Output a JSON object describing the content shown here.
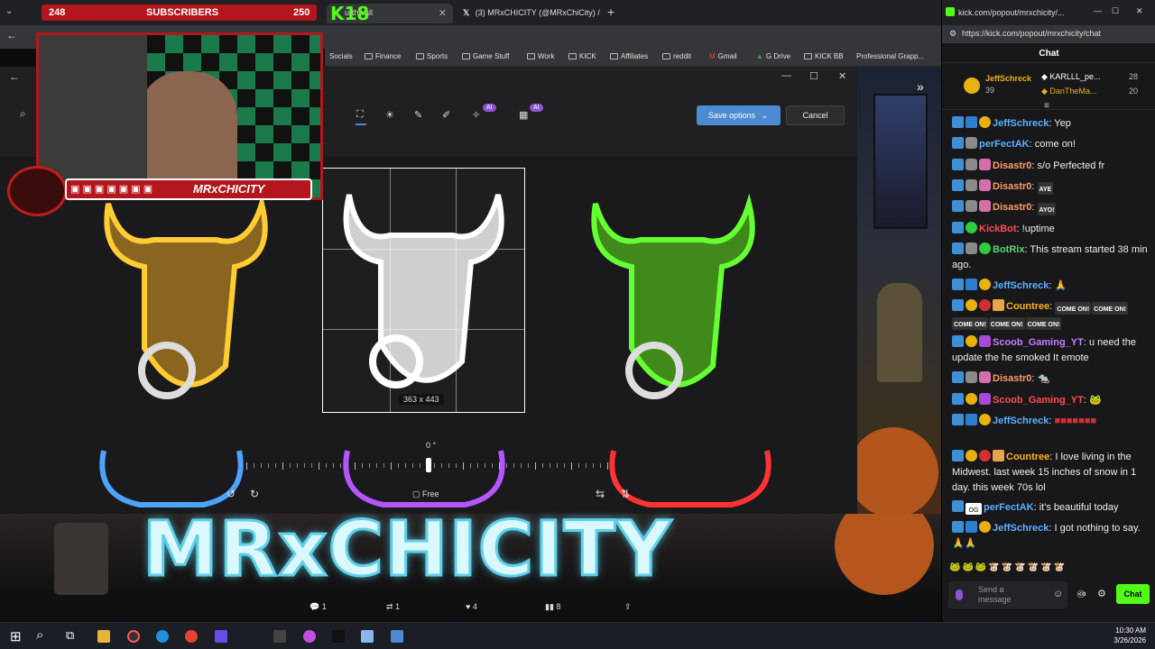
{
  "browser": {
    "subscribers_bar": {
      "count": "248",
      "label": "SUBSCRIBERS",
      "goal": "250",
      "kick_count": "18"
    },
    "tabs": [
      {
        "label": "urthwall"
      },
      {
        "label": "(3) MRxCHICITY (@MRxChiCity) / X"
      }
    ],
    "bookmarks": [
      "Socials",
      "Finance",
      "Sports",
      "Game Stuff",
      "Work",
      "KICK",
      "Affiliates",
      "reddit",
      "Gmail",
      "G Drive",
      "KICK BB",
      "Professional Grapp..."
    ]
  },
  "editor": {
    "save_label": "Save options",
    "cancel_label": "Cancel",
    "ai_badge": "AI",
    "crop_size": "363 x 443",
    "rotation": "0 °",
    "free_label": "Free"
  },
  "overlay": {
    "channel_name": "MRxCHICITY",
    "banner_title": "MRxCHICITY"
  },
  "tweet_actions": {
    "replies": "1",
    "reposts": "1",
    "likes": "4",
    "views": "8"
  },
  "chat": {
    "window_url": "kick.com/popout/mrxchicity/...",
    "url": "https://kick.com/popout/mrxchicity/chat",
    "title": "Chat",
    "leaders": [
      {
        "name": "JeffSchreck",
        "value": "39"
      },
      {
        "name": "KARLLL_pe...",
        "value": "28"
      },
      {
        "name": "DanTheMa...",
        "value": "20"
      }
    ],
    "messages": [
      {
        "user": "JeffSchreck",
        "color": "#5bb0ff",
        "text": ": Yep"
      },
      {
        "user": "perFectAK",
        "color": "#5bb0ff",
        "text": ": come on!"
      },
      {
        "user": "Disastr0",
        "color": "#ff9c6b",
        "text": ": s/o Perfected fr"
      },
      {
        "user": "Disastr0",
        "color": "#ff9c6b",
        "text": ":"
      },
      {
        "user": "Disastr0",
        "color": "#ff9c6b",
        "text": ":"
      },
      {
        "user": "KickBot",
        "color": "#ff4d4d",
        "text": ": !uptime"
      },
      {
        "user": "BotRix",
        "color": "#5bd86c",
        "text": ": This stream started 38 min ago."
      },
      {
        "user": "JeffSchreck",
        "color": "#5bb0ff",
        "text": ":"
      },
      {
        "user": "Countree",
        "color": "#ffb020",
        "text": ":"
      },
      {
        "user": "Scoob_Gaming_YT",
        "color": "#c77dff",
        "text": ": u need the update the he smoked It emote"
      },
      {
        "user": "Disastr0",
        "color": "#ff9c6b",
        "text": ":"
      },
      {
        "user": "Scoob_Gaming_YT",
        "color": "#c77dff",
        "text": ":"
      },
      {
        "user": "JeffSchreck",
        "color": "#5bb0ff",
        "text": ":"
      },
      {
        "user": "Countree",
        "color": "#ffb020",
        "text": ": I love living in the Midwest. last week 15 inches of snow in 1 day. this week 70s lol"
      },
      {
        "user": "perFectAK",
        "color": "#5bb0ff",
        "text": ": it's beautiful today"
      },
      {
        "user": "JeffSchreck",
        "color": "#5bb0ff",
        "text": ": I got nothing to say."
      }
    ],
    "emotes": {
      "aye": "AYE",
      "ayo": "AYO!",
      "come_on": "COME ON!"
    },
    "input_placeholder": "Send a message",
    "send_label": "Chat"
  },
  "taskbar": {
    "time": "10:30 AM",
    "date": "3/26/2026"
  },
  "colors": {
    "kick_green": "#53fc18",
    "brand_red": "#b3161c",
    "save_blue": "#4c8bd1"
  }
}
